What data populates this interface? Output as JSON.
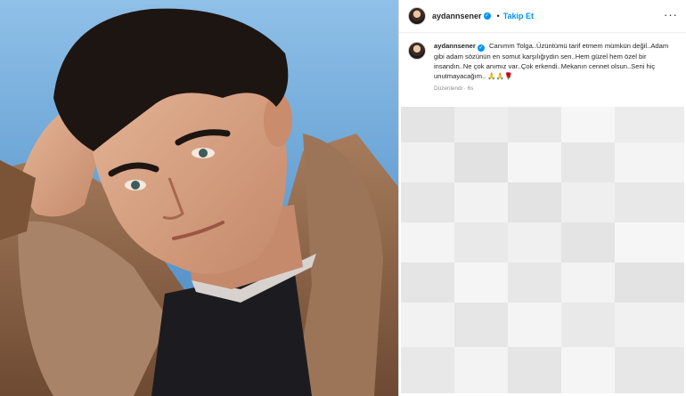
{
  "post": {
    "username": "aydannsener",
    "follow_label": "Takip Et",
    "separator": "•",
    "more_label": "···",
    "verified_mark": "✓",
    "caption": "Canımm Tolga..Üzüntümü tarif etmem mümkün değil..Adam gibi adam sözünün en somut karşılığıydın sen..Hem güzel hem özel bir insandın..Ne çok anımız var..Çok erkendi..Mekanın cennet olsun..Seni hiç unutmayacağım.. 🙏🙏🌹",
    "edited_label": "Düzenlendi",
    "time_label": "6s"
  },
  "icons": [
    "avatar",
    "verified-badge-icon",
    "more-options-icon"
  ],
  "colors": {
    "accent": "#0095f6",
    "text": "#262626",
    "muted": "#8e8e8e",
    "sky": "#6fa7d6",
    "jacket": "#7a5237"
  }
}
